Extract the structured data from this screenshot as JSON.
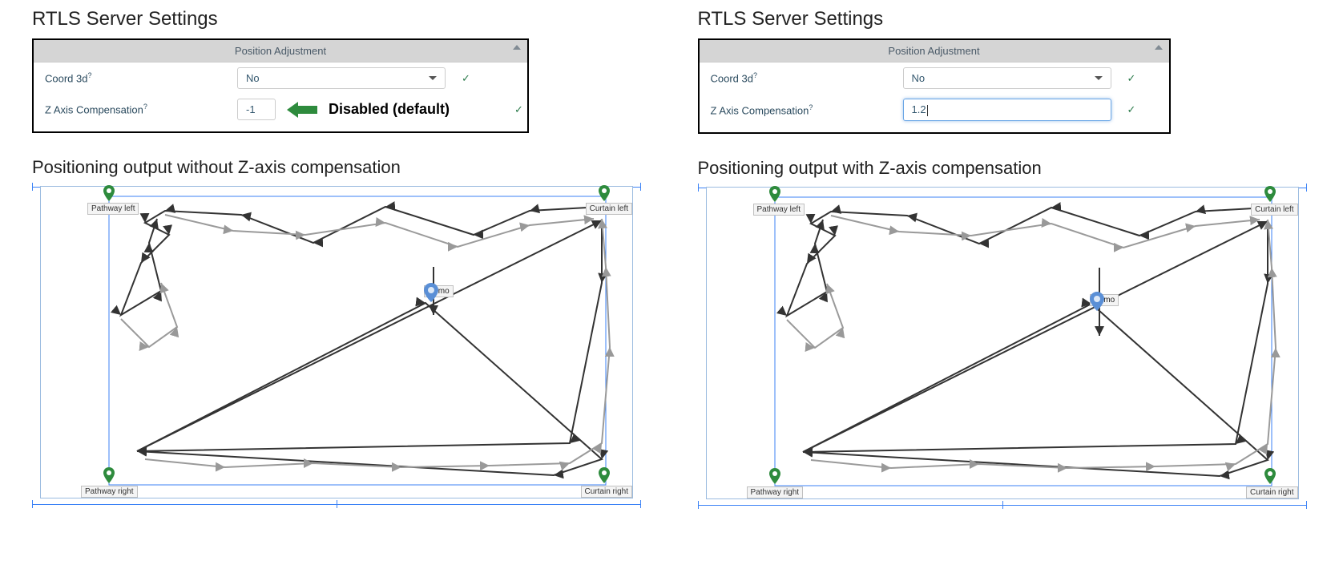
{
  "left": {
    "title": "RTLS Server Settings",
    "panel_header": "Position Adjustment",
    "rows": {
      "coord3d": {
        "label": "Coord 3d",
        "help": "?",
        "value": "No"
      },
      "zaxis": {
        "label": "Z Axis Compensation",
        "help": "?",
        "value": "-1"
      }
    },
    "annotation": "Disabled (default)",
    "output_title": "Positioning output without Z-axis compensation"
  },
  "right": {
    "title": "RTLS Server Settings",
    "panel_header": "Position Adjustment",
    "rows": {
      "coord3d": {
        "label": "Coord 3d",
        "help": "?",
        "value": "No"
      },
      "zaxis": {
        "label": "Z Axis Compensation",
        "help": "?",
        "value": "1.2"
      }
    },
    "output_title": "Positioning output with Z-axis compensation"
  },
  "map": {
    "corners": {
      "tl": "Pathway left",
      "tr": "Curtain left",
      "bl": "Pathway right",
      "br": "Curtain right"
    },
    "tag": "Demo"
  }
}
